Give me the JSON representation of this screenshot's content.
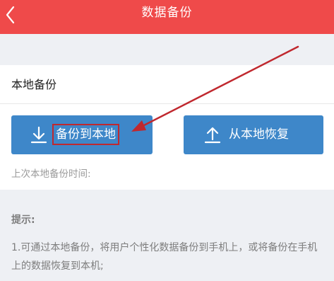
{
  "header": {
    "title": "数据备份",
    "back_icon": "chevron-left-icon"
  },
  "local_backup": {
    "section_title": "本地备份",
    "backup_button": {
      "label": "备份到本地",
      "icon": "download-icon"
    },
    "restore_button": {
      "label": "从本地恢复",
      "icon": "upload-icon"
    },
    "last_backup_label": "上次本地备份时间:"
  },
  "tips": {
    "title": "提示:",
    "text": "1.可通过本地备份，将用户个性化数据备份到手机上，或将备份在手机上的数据恢复到本机;"
  },
  "colors": {
    "header_bg": "#ef4a4a",
    "button_bg": "#3e87c9",
    "annotation": "#c0282e"
  }
}
